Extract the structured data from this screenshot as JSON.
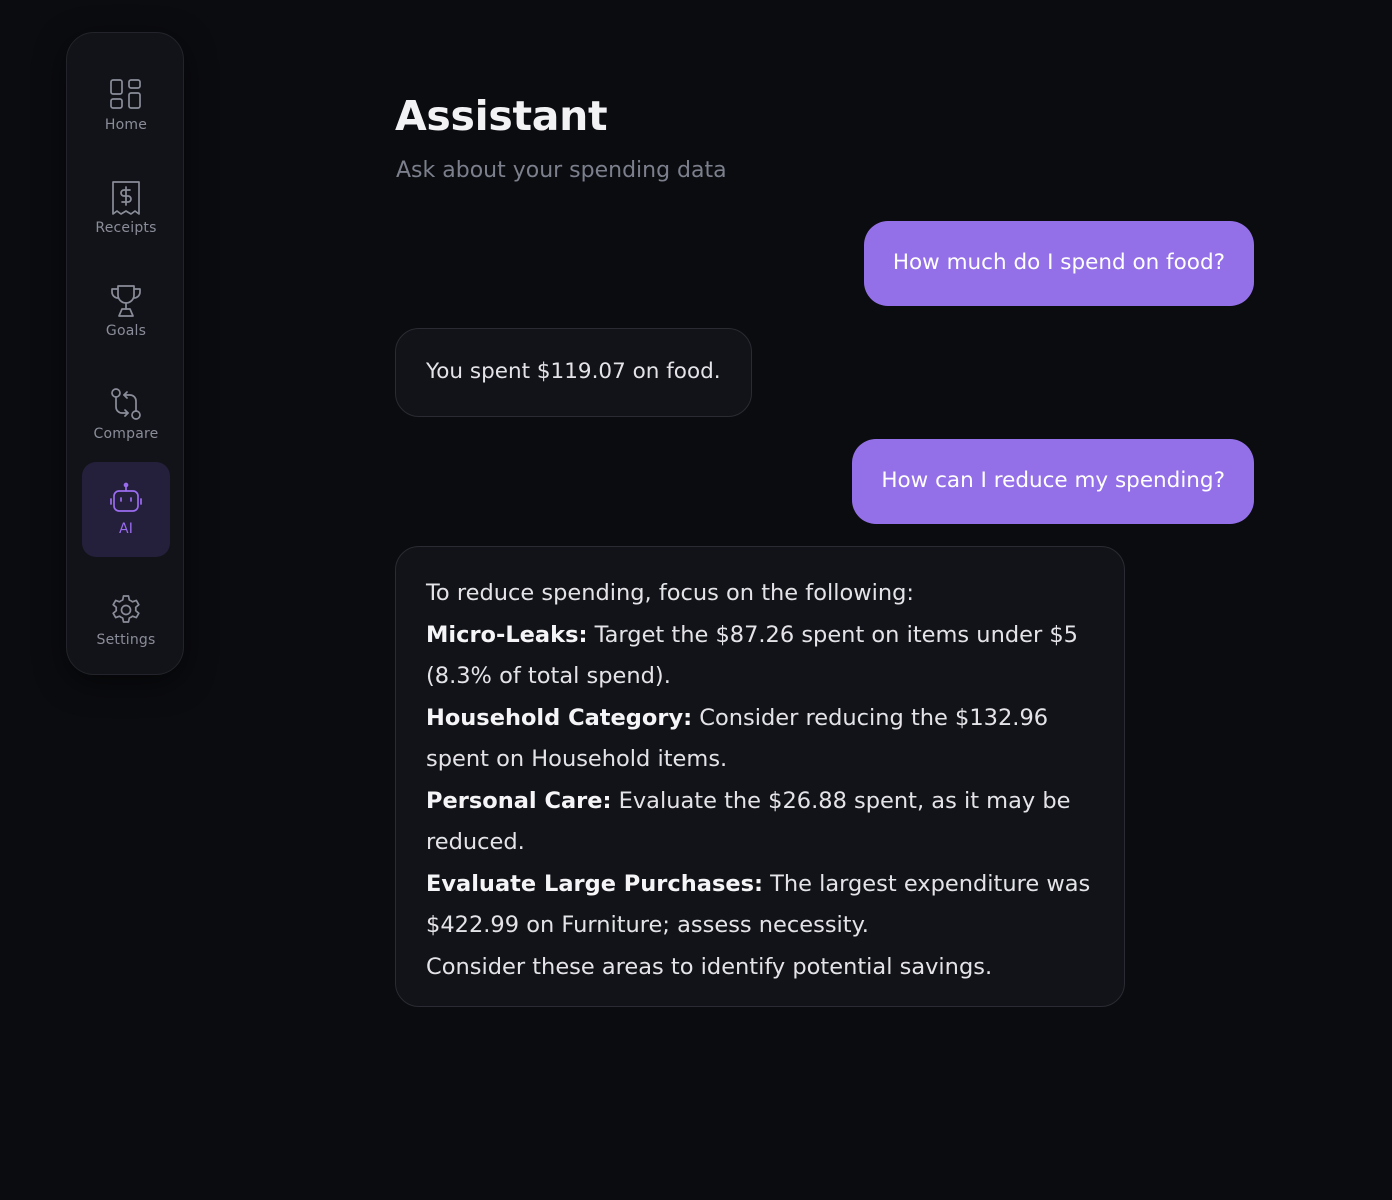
{
  "sidebar": {
    "items": [
      {
        "label": "Home",
        "icon": "grid-icon"
      },
      {
        "label": "Receipts",
        "icon": "receipt-icon"
      },
      {
        "label": "Goals",
        "icon": "trophy-icon"
      },
      {
        "label": "Compare",
        "icon": "compare-icon"
      },
      {
        "label": "AI",
        "icon": "robot-icon",
        "active": true
      },
      {
        "label": "Settings",
        "icon": "gear-icon"
      }
    ]
  },
  "header": {
    "title": "Assistant",
    "subtitle": "Ask about your spending data"
  },
  "chat": {
    "messages": [
      {
        "role": "user",
        "text": "How much do I spend on food?"
      },
      {
        "role": "assistant",
        "text": "You spent $119.07 on food."
      },
      {
        "role": "user",
        "text": "How can I reduce my spending?"
      },
      {
        "role": "assistant",
        "intro": "To reduce spending, focus on the following:",
        "points": [
          {
            "title": "Micro-Leaks:",
            "text": " Target the $87.26 spent on items under $5 (8.3% of total spend)."
          },
          {
            "title": "Household Category:",
            "text": " Consider reducing the $132.96 spent on Household items."
          },
          {
            "title": "Personal Care:",
            "text": " Evaluate the $26.88 spent, as it may be reduced."
          },
          {
            "title": "Evaluate Large Purchases:",
            "text": " The largest expenditure was $422.99 on Furniture; assess necessity."
          }
        ],
        "outro": "Consider these areas to identify potential savings."
      }
    ]
  },
  "colors": {
    "background": "#0b0c10",
    "accent": "#9470e8",
    "active_nav": "#9a6cf0"
  }
}
